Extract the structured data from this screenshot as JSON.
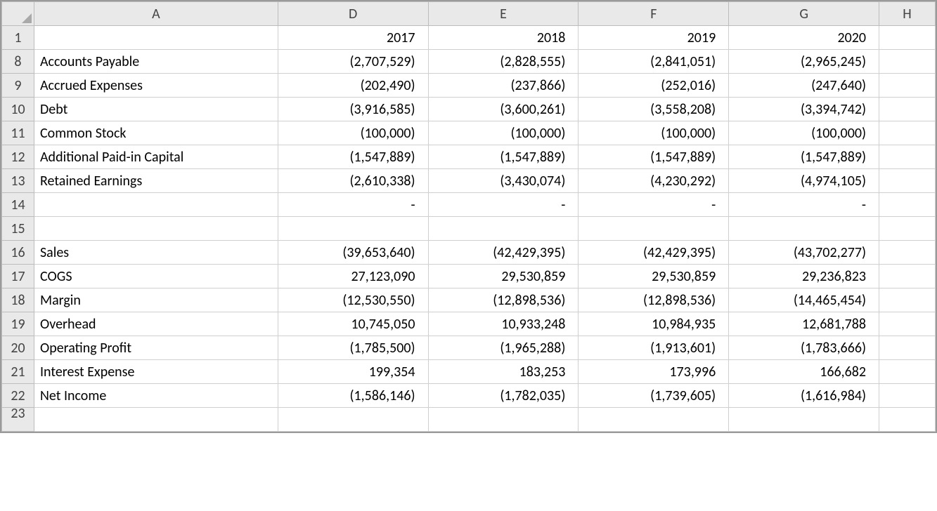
{
  "columns": {
    "rowhead": "",
    "A": "A",
    "D": "D",
    "E": "E",
    "F": "F",
    "G": "G",
    "H": "H"
  },
  "rows": [
    {
      "n": "1",
      "label": "",
      "D": "2017",
      "E": "2018",
      "F": "2019",
      "G": "2020"
    },
    {
      "n": "8",
      "label": "Accounts Payable",
      "D": "(2,707,529)",
      "E": "(2,828,555)",
      "F": "(2,841,051)",
      "G": "(2,965,245)"
    },
    {
      "n": "9",
      "label": "Accrued Expenses",
      "D": "(202,490)",
      "E": "(237,866)",
      "F": "(252,016)",
      "G": "(247,640)"
    },
    {
      "n": "10",
      "label": "Debt",
      "D": "(3,916,585)",
      "E": "(3,600,261)",
      "F": "(3,558,208)",
      "G": "(3,394,742)"
    },
    {
      "n": "11",
      "label": "Common Stock",
      "D": "(100,000)",
      "E": "(100,000)",
      "F": "(100,000)",
      "G": "(100,000)"
    },
    {
      "n": "12",
      "label": "Additional Paid-in Capital",
      "D": "(1,547,889)",
      "E": "(1,547,889)",
      "F": "(1,547,889)",
      "G": "(1,547,889)"
    },
    {
      "n": "13",
      "label": "Retained Earnings",
      "D": "(2,610,338)",
      "E": "(3,430,074)",
      "F": "(4,230,292)",
      "G": "(4,974,105)"
    },
    {
      "n": "14",
      "label": "",
      "D": "-",
      "E": "-",
      "F": "-",
      "G": "-"
    },
    {
      "n": "15",
      "label": "",
      "D": "",
      "E": "",
      "F": "",
      "G": ""
    },
    {
      "n": "16",
      "label": "Sales",
      "D": "(39,653,640)",
      "E": "(42,429,395)",
      "F": "(42,429,395)",
      "G": "(43,702,277)"
    },
    {
      "n": "17",
      "label": "COGS",
      "D": "27,123,090",
      "E": "29,530,859",
      "F": "29,530,859",
      "G": "29,236,823"
    },
    {
      "n": "18",
      "label": "Margin",
      "D": "(12,530,550)",
      "E": "(12,898,536)",
      "F": "(12,898,536)",
      "G": "(14,465,454)"
    },
    {
      "n": "19",
      "label": "Overhead",
      "D": "10,745,050",
      "E": "10,933,248",
      "F": "10,984,935",
      "G": "12,681,788"
    },
    {
      "n": "20",
      "label": "Operating Profit",
      "D": "(1,785,500)",
      "E": "(1,965,288)",
      "F": "(1,913,601)",
      "G": "(1,783,666)"
    },
    {
      "n": "21",
      "label": "Interest Expense",
      "D": "199,354",
      "E": "183,253",
      "F": "173,996",
      "G": "166,682"
    },
    {
      "n": "22",
      "label": "Net Income",
      "D": "(1,586,146)",
      "E": "(1,782,035)",
      "F": "(1,739,605)",
      "G": "(1,616,984)"
    }
  ],
  "cutrow": "23"
}
